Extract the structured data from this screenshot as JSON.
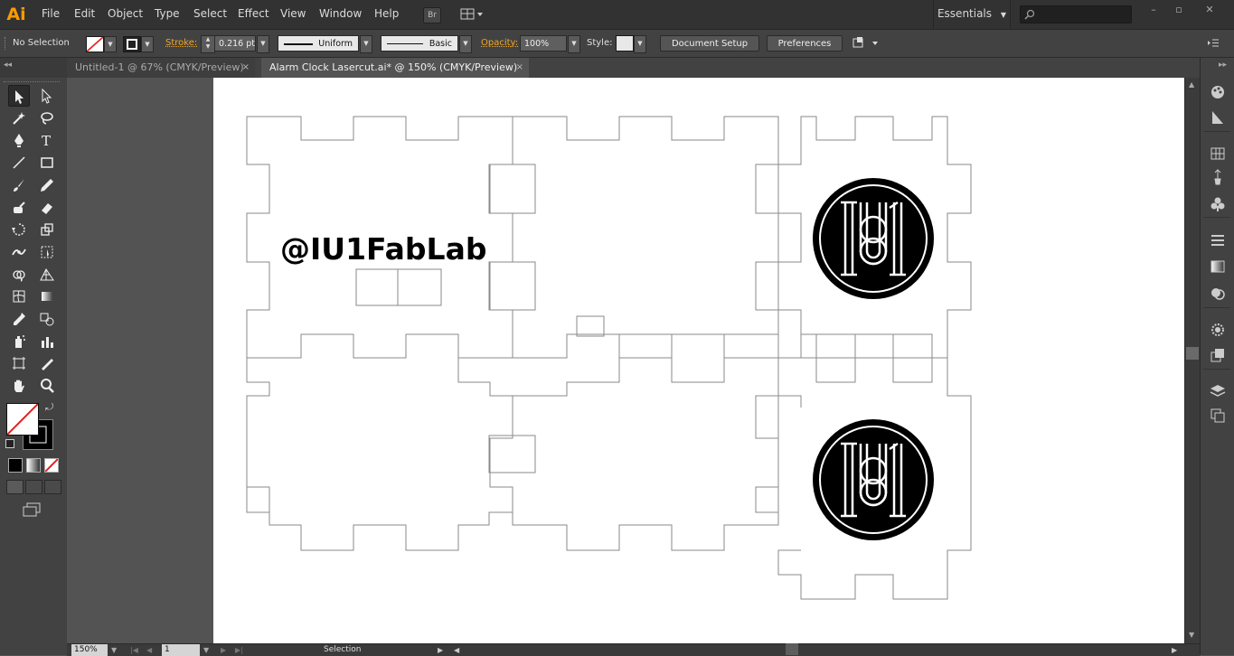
{
  "app": {
    "logo": "Ai",
    "accent_color": "#ff9a00"
  },
  "menu": {
    "items": [
      "File",
      "Edit",
      "Object",
      "Type",
      "Select",
      "Effect",
      "View",
      "Window",
      "Help"
    ],
    "bridge_label": "Br",
    "arrange_icon": "arrange-documents-icon"
  },
  "workspace": {
    "label": "Essentials"
  },
  "search": {
    "placeholder": "",
    "icon": "search-icon"
  },
  "window_controls": {
    "minimize": "–",
    "restore": "▫",
    "close": "✕"
  },
  "control_bar": {
    "selection_status": "No Selection",
    "stroke_label": "Stroke:",
    "stroke_weight": "0.216 pt",
    "variable_width_profile": "Uniform",
    "brush": "Basic",
    "opacity_label": "Opacity:",
    "opacity": "100%",
    "style_label": "Style:",
    "document_setup_button": "Document Setup",
    "preferences_button": "Preferences"
  },
  "tabs": [
    {
      "title": "Untitled-1 @ 67% (CMYK/Preview)",
      "active": false,
      "close": "×"
    },
    {
      "title": "Alarm Clock Lasercut.ai* @ 150% (CMYK/Preview)",
      "active": true,
      "close": "×"
    }
  ],
  "tools": [
    "selection-tool-icon",
    "direct-selection-tool-icon",
    "magic-wand-tool-icon",
    "lasso-tool-icon",
    "pen-tool-icon",
    "type-tool-icon",
    "line-segment-tool-icon",
    "rectangle-tool-icon",
    "paintbrush-tool-icon",
    "pencil-tool-icon",
    "blob-brush-tool-icon",
    "eraser-tool-icon",
    "rotate-tool-icon",
    "scale-tool-icon",
    "width-tool-icon",
    "free-transform-tool-icon",
    "shape-builder-tool-icon",
    "perspective-grid-tool-icon",
    "mesh-tool-icon",
    "gradient-tool-icon",
    "eyedropper-tool-icon",
    "blend-tool-icon",
    "symbol-sprayer-tool-icon",
    "column-graph-tool-icon",
    "artboard-tool-icon",
    "slice-tool-icon",
    "hand-tool-icon",
    "zoom-tool-icon"
  ],
  "artwork": {
    "text": "@IU1FabLab",
    "logo_glyph": "IU1",
    "stroke_color": "#8a8a8a",
    "fill_color": "#000000"
  },
  "dock_icons": [
    "color-panel-icon",
    "color-guide-icon",
    "swatches-panel-icon",
    "brushes-panel-icon",
    "symbols-panel-icon",
    "stroke-panel-icon",
    "gradient-panel-icon",
    "transparency-panel-icon",
    "appearance-panel-icon",
    "graphic-styles-panel-icon",
    "layers-panel-icon",
    "artboards-panel-icon"
  ],
  "status_bar": {
    "zoom": "150%",
    "artboard_number": "1",
    "current_tool": "Selection"
  }
}
